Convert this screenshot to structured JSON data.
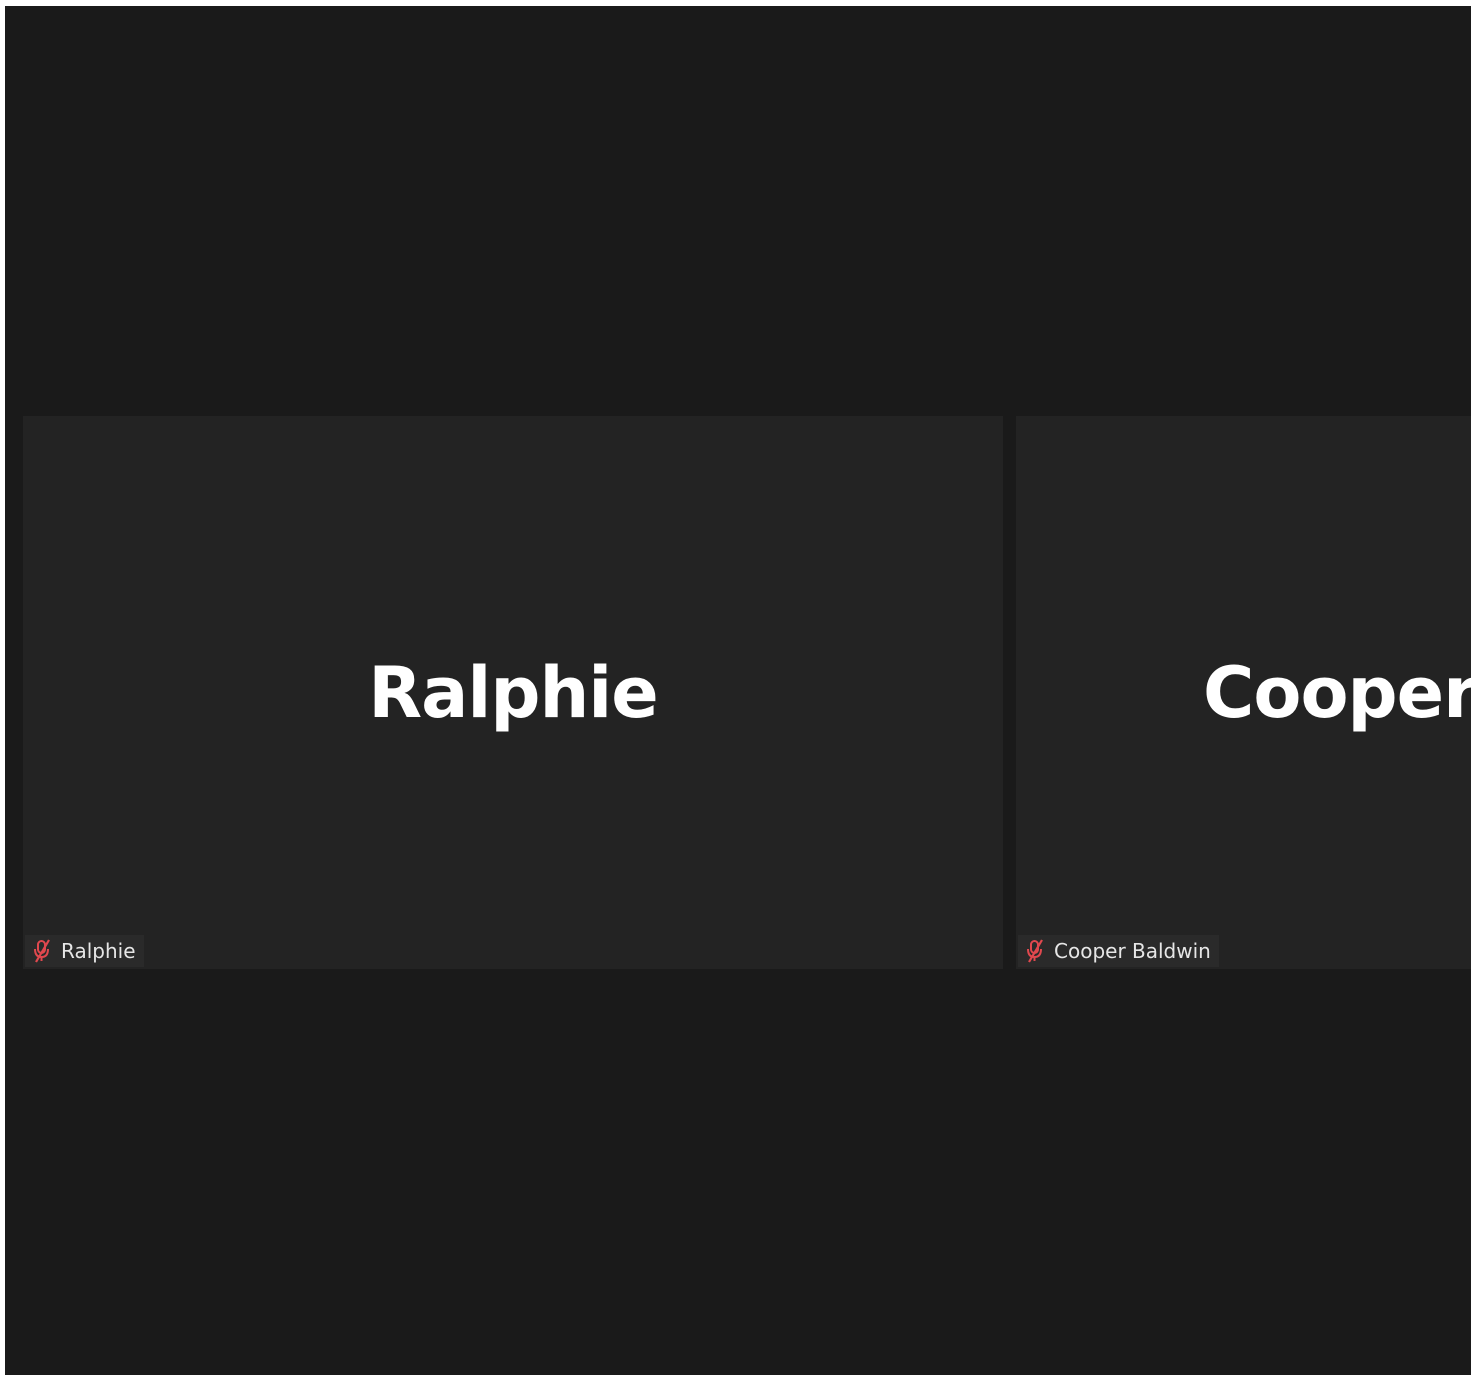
{
  "participants": [
    {
      "display_name": "Ralphie",
      "label": "Ralphie",
      "muted": true
    },
    {
      "display_name": "Cooper",
      "label": "Cooper Baldwin",
      "muted": true
    }
  ],
  "colors": {
    "background": "#1a1a1a",
    "tile": "#232323",
    "muted_icon": "#e0484e",
    "text": "#ffffff"
  },
  "icons": {
    "muted": "microphone-muted-icon"
  }
}
